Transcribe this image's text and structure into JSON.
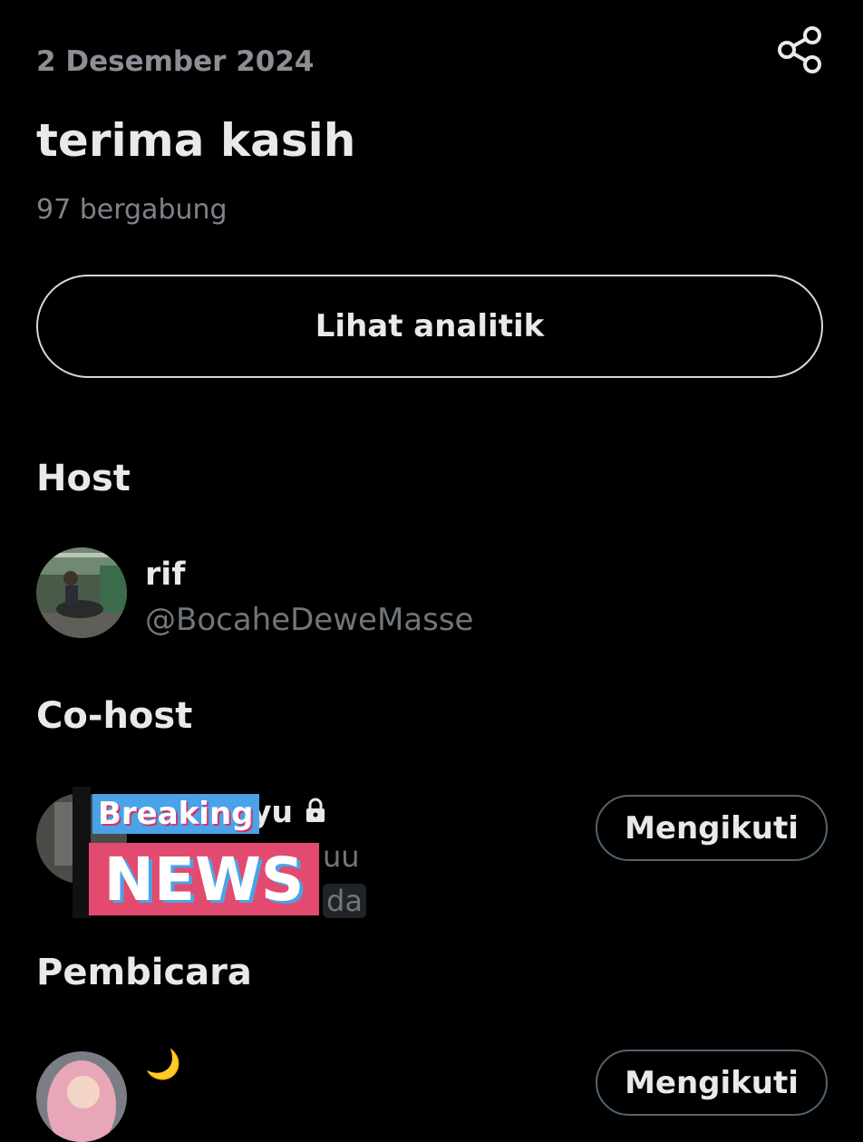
{
  "space": {
    "date": "2 Desember 2024",
    "title": "terima kasih",
    "joined": "97 bergabung",
    "analytics_label": "Lihat analitik"
  },
  "sections": {
    "host": "Host",
    "cohost": "Co-host",
    "speakers": "Pembicara"
  },
  "host": {
    "name": "rif",
    "handle": "@BocaheDeweMasse"
  },
  "cohost": {
    "name_suffix": "yu",
    "handle_fragment": "uu",
    "badge_fragment": "da",
    "follow_label": "Mengikuti",
    "overlay_top": "Breaking",
    "overlay_bottom": "NEWS"
  },
  "speaker": {
    "name": "🌙",
    "follow_label": "Mengikuti"
  },
  "icons": [
    "share-icon",
    "lock-icon"
  ]
}
